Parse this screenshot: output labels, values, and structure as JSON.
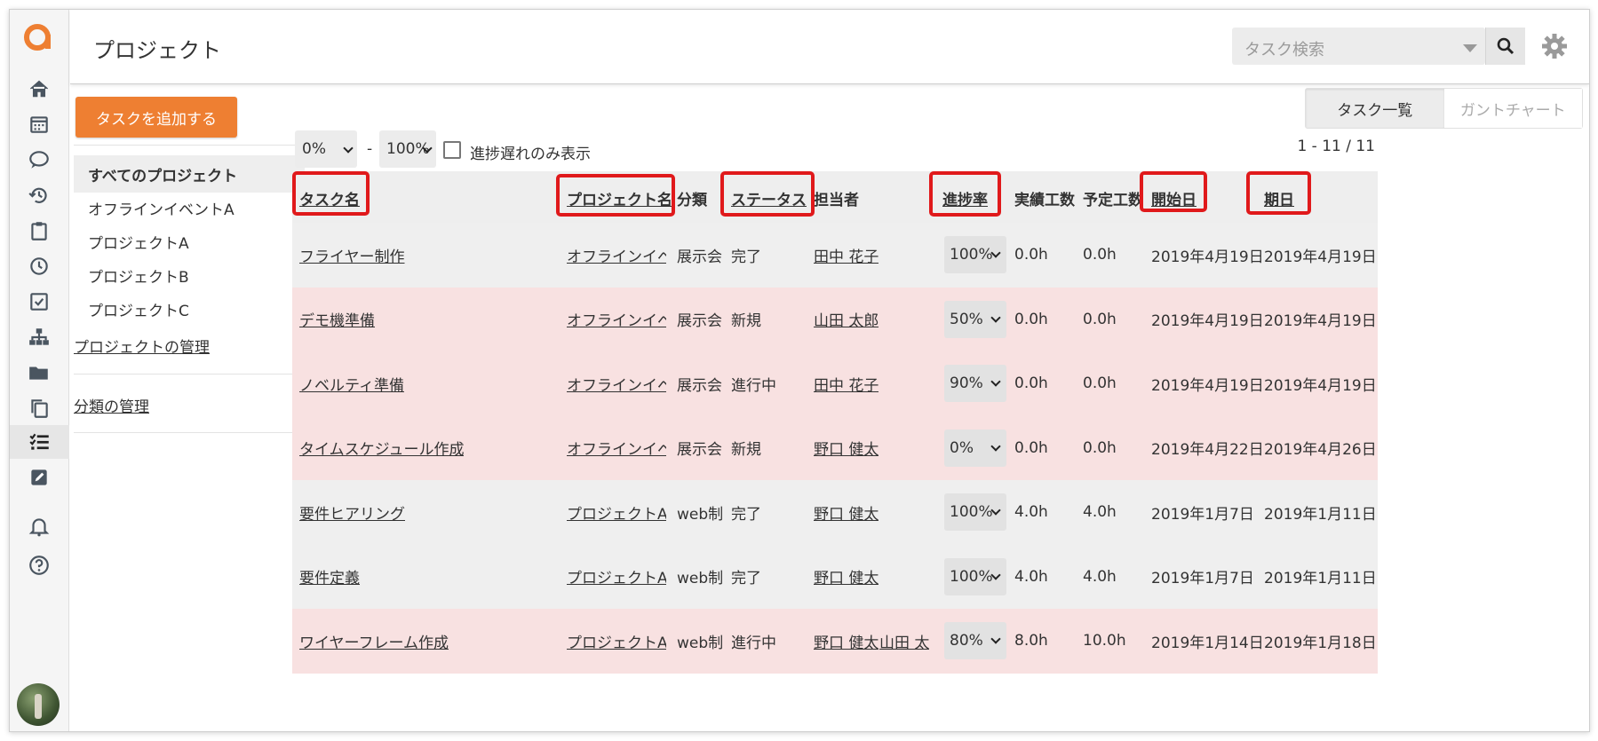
{
  "header": {
    "title": "プロジェクト",
    "search_placeholder": "タスク検索"
  },
  "sidebar_icons": [
    "home-icon",
    "calendar-icon",
    "chat-icon",
    "history-icon",
    "clipboard-icon",
    "clock-icon",
    "checkbox-icon",
    "org-chart-icon",
    "folder-icon",
    "copy-icon",
    "task-list-icon",
    "edit-icon",
    "bell-icon",
    "help-icon"
  ],
  "panel": {
    "add_task_label": "タスクを追加する",
    "projects": [
      "すべてのプロジェクト",
      "オフラインイベントA",
      "プロジェクトA",
      "プロジェクトB",
      "プロジェクトC"
    ],
    "manage_projects": "プロジェクトの管理",
    "manage_categories": "分類の管理"
  },
  "toolbar": {
    "range_from": "0%",
    "range_sep": "-",
    "range_to": "100%",
    "delay_only_label": "進捗遅れのみ表示",
    "count": "1 - 11 / 11",
    "view_tabs": [
      "タスク一覧",
      "ガントチャート"
    ]
  },
  "table": {
    "headers": [
      "タスク名",
      "プロジェクト名",
      "分類",
      "ステータス",
      "担当者",
      "進捗率",
      "実績工数",
      "予定工数",
      "開始日",
      "期日"
    ],
    "rows": [
      {
        "task": "フライヤー制作",
        "project": "オフラインイベ",
        "category": "展示会",
        "status": "完了",
        "assignee": "田中 花子",
        "assignee2": "",
        "progress": "100%",
        "actual": "0.0h",
        "planned": "0.0h",
        "start": "2019年4月19日",
        "due": "2019年4月19日",
        "late": false
      },
      {
        "task": "デモ機準備",
        "project": "オフラインイベ",
        "category": "展示会",
        "status": "新規",
        "assignee": "山田 太郎",
        "assignee2": "",
        "progress": "50%",
        "actual": "0.0h",
        "planned": "0.0h",
        "start": "2019年4月19日",
        "due": "2019年4月19日",
        "late": true
      },
      {
        "task": "ノベルティ準備",
        "project": "オフラインイベ",
        "category": "展示会",
        "status": "進行中",
        "assignee": "田中 花子",
        "assignee2": "",
        "progress": "90%",
        "actual": "0.0h",
        "planned": "0.0h",
        "start": "2019年4月19日",
        "due": "2019年4月19日",
        "late": true
      },
      {
        "task": "タイムスケジュール作成",
        "project": "オフラインイベ",
        "category": "展示会",
        "status": "新規",
        "assignee": "野口 健太",
        "assignee2": "",
        "progress": "0%",
        "actual": "0.0h",
        "planned": "0.0h",
        "start": "2019年4月22日",
        "due": "2019年4月26日",
        "late": true
      },
      {
        "task": "要件ヒアリング",
        "project": "プロジェクトA",
        "category": "web制",
        "status": "完了",
        "assignee": "野口 健太",
        "assignee2": "",
        "progress": "100%",
        "actual": "4.0h",
        "planned": "4.0h",
        "start": "2019年1月7日",
        "due": "2019年1月11日",
        "late": false
      },
      {
        "task": "要件定義",
        "project": "プロジェクトA",
        "category": "web制",
        "status": "完了",
        "assignee": "野口 健太",
        "assignee2": "",
        "progress": "100%",
        "actual": "4.0h",
        "planned": "4.0h",
        "start": "2019年1月7日",
        "due": "2019年1月11日",
        "late": false
      },
      {
        "task": "ワイヤーフレーム作成",
        "project": "プロジェクトA",
        "category": "web制",
        "status": "進行中",
        "assignee": "野口 健太",
        "assignee2": "山田 太",
        "progress": "80%",
        "actual": "8.0h",
        "planned": "10.0h",
        "start": "2019年1月14日",
        "due": "2019年1月18日",
        "late": true
      }
    ]
  },
  "colors": {
    "accent": "#ee7f32",
    "highlight": "#e0191b",
    "late_row": "#f8e1e1",
    "normal_row": "#efefef"
  }
}
